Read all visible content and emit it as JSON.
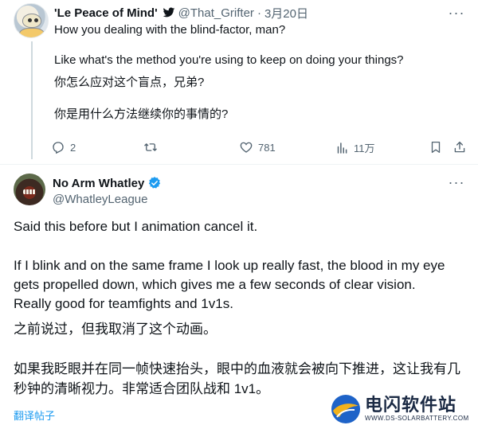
{
  "tweet1": {
    "display_name": "'Le Peace of Mind'",
    "handle": "@That_Grifter",
    "separator": "·",
    "date": "3月20日",
    "lines": [
      "How you dealing with the blind-factor, man?",
      "Like what's the method you're using to keep on doing your things?",
      "你怎么应对这个盲点，兄弟?",
      "你是用什么方法继续你的事情的?"
    ],
    "actions": {
      "reply_count": "2",
      "retweet_count": "",
      "like_count": "781",
      "view_count": "11万"
    }
  },
  "tweet2": {
    "display_name": "No Arm Whatley",
    "handle": "@WhatleyLeague",
    "lines": [
      "Said this before but I animation cancel it.",
      "If I blink and on the same frame I look up really fast, the blood in my eye",
      "gets propelled down, which gives me a few seconds of clear vision.",
      "Really good for teamfights and 1v1s.",
      "之前说过，但我取消了这个动画。",
      "如果我眨眼并在同一帧快速抬头，眼中的血液就会被向下推进，这让我有几",
      "秒钟的清晰视力。非常适合团队战和 1v1。"
    ],
    "translate_label": "翻译帖子"
  },
  "watermark": {
    "title": "电闪软件站",
    "url": "WWW.DS-SOLARBATTERY.COM"
  },
  "colors": {
    "text_primary": "#0f1419",
    "text_secondary": "#536471",
    "accent": "#1d9bf0",
    "divider": "#eff3f4"
  }
}
